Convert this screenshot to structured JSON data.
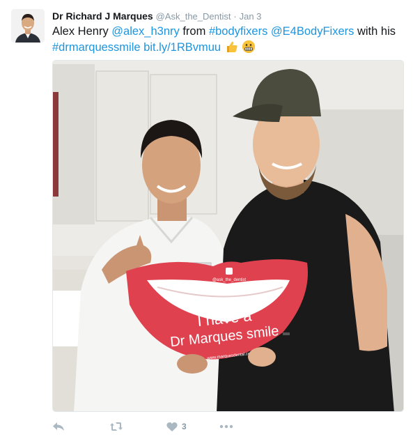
{
  "tweet": {
    "author_name": "Dr Richard J Marques",
    "author_handle": "@Ask_the_Dentist",
    "separator": "·",
    "timestamp": "Jan 3",
    "text_segments": [
      {
        "text": "Alex Henry ",
        "kind": "plain"
      },
      {
        "text": "@alex_h3nry",
        "kind": "link"
      },
      {
        "text": " from ",
        "kind": "plain"
      },
      {
        "text": "#bodyfixers",
        "kind": "link"
      },
      {
        "text": " ",
        "kind": "plain"
      },
      {
        "text": "@E4BodyFixers",
        "kind": "link"
      },
      {
        "text": " with his ",
        "kind": "plain"
      },
      {
        "text": "#drmarquessmile",
        "kind": "link"
      },
      {
        "text": " ",
        "kind": "plain"
      },
      {
        "text": "bit.ly/1RBvmuu",
        "kind": "link"
      }
    ],
    "emojis": [
      "thumbs-up-emoji",
      "grimacing-face-emoji"
    ]
  },
  "photo": {
    "sign_line1": "I have a",
    "sign_line2": "Dr Marques smile",
    "sign_handle": "@ask_the_dentist",
    "sign_footer": "www.marquesdental.com",
    "badge_text": "Dr Marques"
  },
  "actions": {
    "like_count": "3",
    "icons": [
      "reply-icon",
      "retweet-icon",
      "like-icon",
      "more-icon"
    ]
  },
  "colors": {
    "link": "#1b95e0",
    "meta": "#8899a6",
    "text": "#14171a",
    "lips": "#e0414f"
  }
}
